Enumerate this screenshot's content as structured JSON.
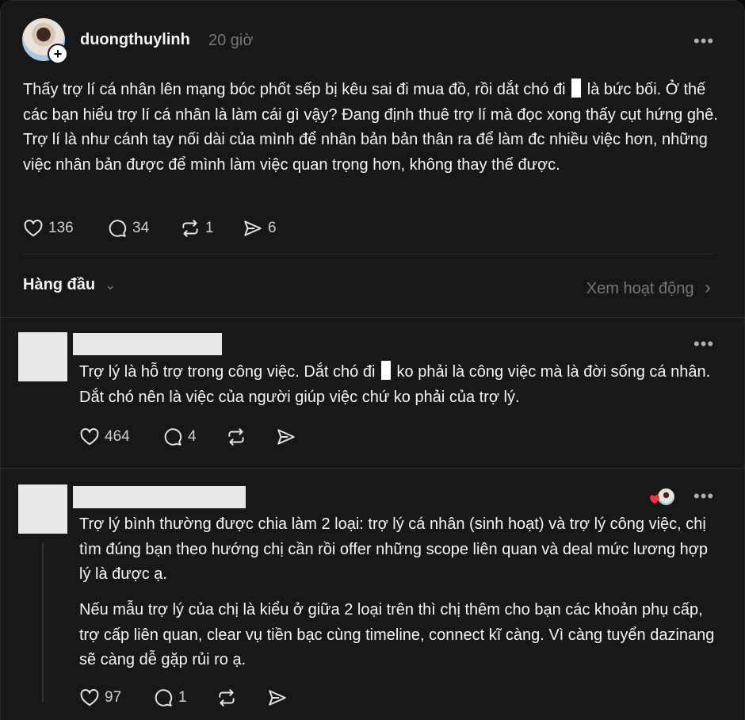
{
  "post": {
    "username": "duongthuylinh",
    "time": "20 giờ",
    "text_1": "Thấy trợ lí cá nhân lên mạng bóc phốt sếp bị kêu sai đi mua đồ, rồi dắt chó đi",
    "text_2": "là bức bối. Ở thế các bạn hiểu trợ lí cá nhân là làm cái gì vậy? Đang định thuê trợ lí mà đọc xong thấy cụt hứng ghê. Trợ lí là như cánh tay nối dài của mình để nhân bản bản thân ra để làm đc nhiều việc hơn, những việc nhân bản được để mình làm việc quan trọng hơn, không thay thế được.",
    "likes": "136",
    "comments": "34",
    "reposts": "1",
    "shares": "6"
  },
  "sort": {
    "label": "Hàng đầu",
    "activity": "Xem hoạt động"
  },
  "replies": [
    {
      "text_1": "Trợ lý là hỗ trợ trong công việc. Dắt chó đi",
      "text_2": "ko phải là công việc mà là đời sống cá nhân. Dắt chó nên là việc của người giúp việc chứ ko phải của trợ lý.",
      "likes": "464",
      "comments": "4"
    },
    {
      "paragraph_1": "Trợ lý bình thường được chia làm 2 loại: trợ lý cá nhân (sinh hoạt) và trợ lý công việc, chị tìm đúng bạn theo hướng chị cần rồi offer những scope liên quan và deal mức lương hợp lý là được ạ.",
      "paragraph_2": "Nếu mẫu trợ lý của chị là kiểu ở giữa 2 loại trên thì chị thêm cho bạn các khoản phụ cấp, trợ cấp liên quan, clear vụ tiền bạc cùng timeline, connect kĩ càng. Vì càng tuyển dazinang sẽ càng dễ gặp rủi ro ạ.",
      "likes": "97",
      "comments": "1"
    }
  ],
  "icons": {
    "more": "•••",
    "plus": "+",
    "chevron_down": "⌄",
    "chevron_right": "›"
  },
  "colors": {
    "background": "#181818",
    "text": "#f3f5f7",
    "muted": "#777777",
    "liked_heart": "#ff3040"
  }
}
